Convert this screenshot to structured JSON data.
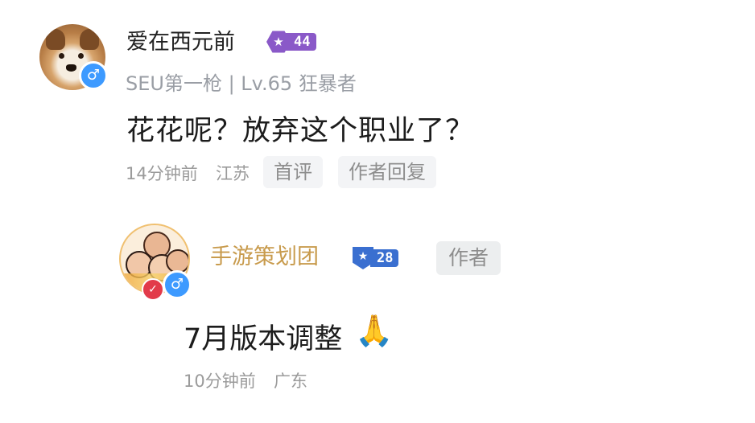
{
  "comment": {
    "username": "爱在西元前",
    "level_icon": "★",
    "level": "44",
    "subtitle": "SEU第一枪 | Lv.65 狂暴者",
    "text": "花花呢？放弃这个职业了？",
    "time": "14分钟前",
    "location": "江苏",
    "gender_icon": "♂",
    "actions": {
      "first_comment": "首评",
      "author_replied": "作者回复"
    }
  },
  "reply": {
    "username": "手游策划团",
    "level_icon": "★",
    "level": "28",
    "author_tag": "作者",
    "text": "7月版本调整",
    "emoji": "🙏",
    "time": "10分钟前",
    "location": "广东",
    "gender_icon": "♂",
    "verify_icon": "✓"
  },
  "colors": {
    "username_author": "#c89b4d",
    "level_purple": "#8a59c8",
    "level_blue": "#3a6fd0",
    "gender_blue": "#3d9aff"
  }
}
